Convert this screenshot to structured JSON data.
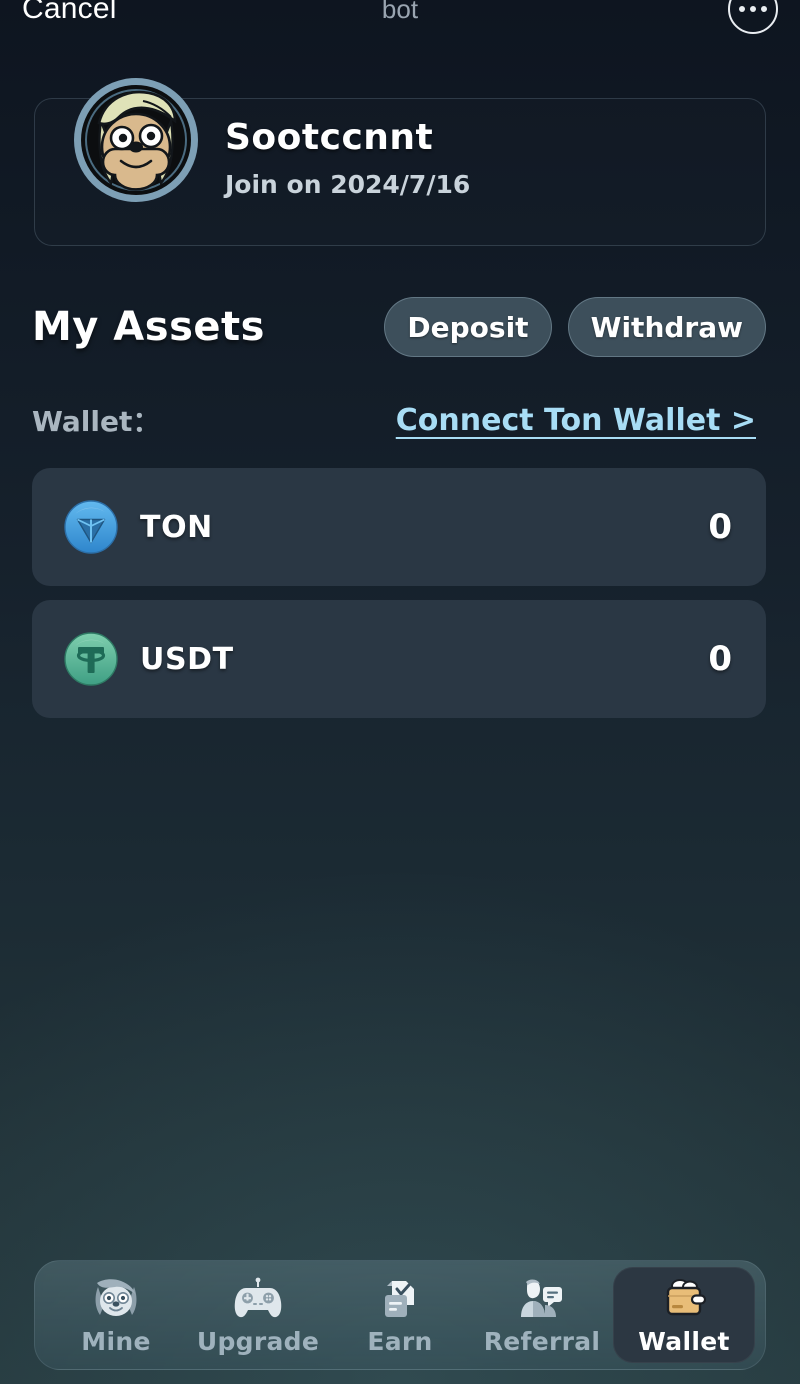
{
  "topbar": {
    "cancel_label": "Cancel",
    "title": "bot",
    "more_icon": "more-horizontal-icon"
  },
  "profile": {
    "avatar_icon": "dog-avatar",
    "name": "Sootccnnt",
    "join_text": "Join on 2024/7/16"
  },
  "assets": {
    "title": "My Assets",
    "deposit_label": "Deposit",
    "withdraw_label": "Withdraw",
    "wallet_label": "Wallet：",
    "connect_link": "Connect Ton Wallet >",
    "rows": [
      {
        "icon": "ton-coin-icon",
        "name": "TON",
        "balance": "0"
      },
      {
        "icon": "usdt-coin-icon",
        "name": "USDT",
        "balance": "0"
      }
    ]
  },
  "tabbar": {
    "items": [
      {
        "icon": "dog-face-icon",
        "label": "Mine",
        "active": false
      },
      {
        "icon": "gamepad-icon",
        "label": "Upgrade",
        "active": false
      },
      {
        "icon": "task-checklist-icon",
        "label": "Earn",
        "active": false
      },
      {
        "icon": "referral-people-icon",
        "label": "Referral",
        "active": false
      },
      {
        "icon": "wallet-icon",
        "label": "Wallet",
        "active": true
      }
    ]
  },
  "colors": {
    "accent_link": "#a8ddf5",
    "card_bg": "#2a3744",
    "button_bg": "#3d4f5b",
    "active_tab_bg": "#2c3742",
    "ton_blue": "#3f9fe0",
    "usdt_green": "#58b493",
    "wallet_tan": "#e8bd78"
  }
}
